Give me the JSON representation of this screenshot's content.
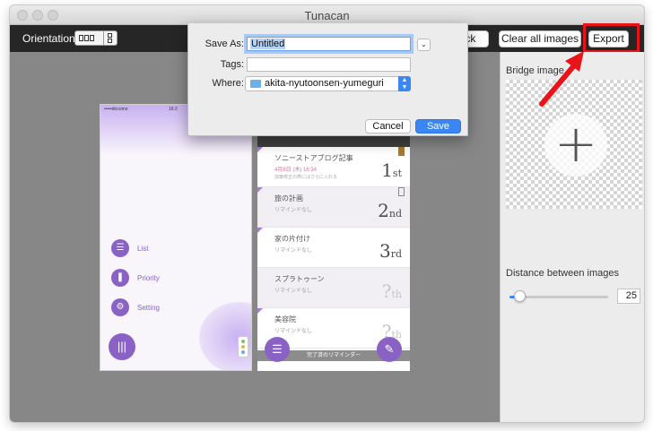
{
  "window": {
    "title": "Tunacan"
  },
  "toolbar": {
    "orientation_label": "Orientation",
    "back_label": "ack",
    "clear_label": "Clear all images",
    "export_label": "Export"
  },
  "save_dialog": {
    "save_as_label": "Save As:",
    "save_as_value": "Untitled",
    "tags_label": "Tags:",
    "tags_value": "",
    "where_label": "Where:",
    "where_value": "akita-nyutoonsen-yumeguri",
    "cancel_label": "Cancel",
    "save_label": "Save"
  },
  "screenshot1": {
    "status_carrier": "•••••docomo",
    "status_time": "16:2",
    "menu": [
      {
        "label": "List",
        "icon": "list-icon",
        "glyph": "☰"
      },
      {
        "label": "Priority",
        "icon": "bookmark-icon",
        "glyph": "❚"
      },
      {
        "label": "Setting",
        "icon": "gear-icon",
        "glyph": "⚙"
      }
    ],
    "fab_glyph": "|||"
  },
  "screenshot2": {
    "rows": [
      {
        "title": "ソニーストアブログ記事",
        "sub": "4月8日 (木) 16:34",
        "sub2": "加筆修正の際にはさらに入れる",
        "rank_num": "1",
        "rank_suffix": "st"
      },
      {
        "title": "旅の計画",
        "sub": "リマインドなし",
        "rank_num": "2",
        "rank_suffix": "nd"
      },
      {
        "title": "家の片付け",
        "sub": "リマインドなし",
        "rank_num": "3",
        "rank_suffix": "rd"
      },
      {
        "title": "スプラトゥーン",
        "sub": "リマインドなし",
        "rank_num": "?",
        "rank_suffix": "th"
      },
      {
        "title": "美容院",
        "sub": "リマインドなし",
        "rank_num": "?",
        "rank_suffix": "th"
      }
    ],
    "done_bar": "完了済のリマインダー"
  },
  "right_panel": {
    "bridge_label": "Bridge image",
    "plus_glyph": "+",
    "distance_label": "Distance between images",
    "distance_value": "25",
    "distance_fraction": 0.1
  },
  "colors": {
    "accent": "#8a62c6",
    "highlight": "#e8141a",
    "primary": "#3b86f5"
  }
}
